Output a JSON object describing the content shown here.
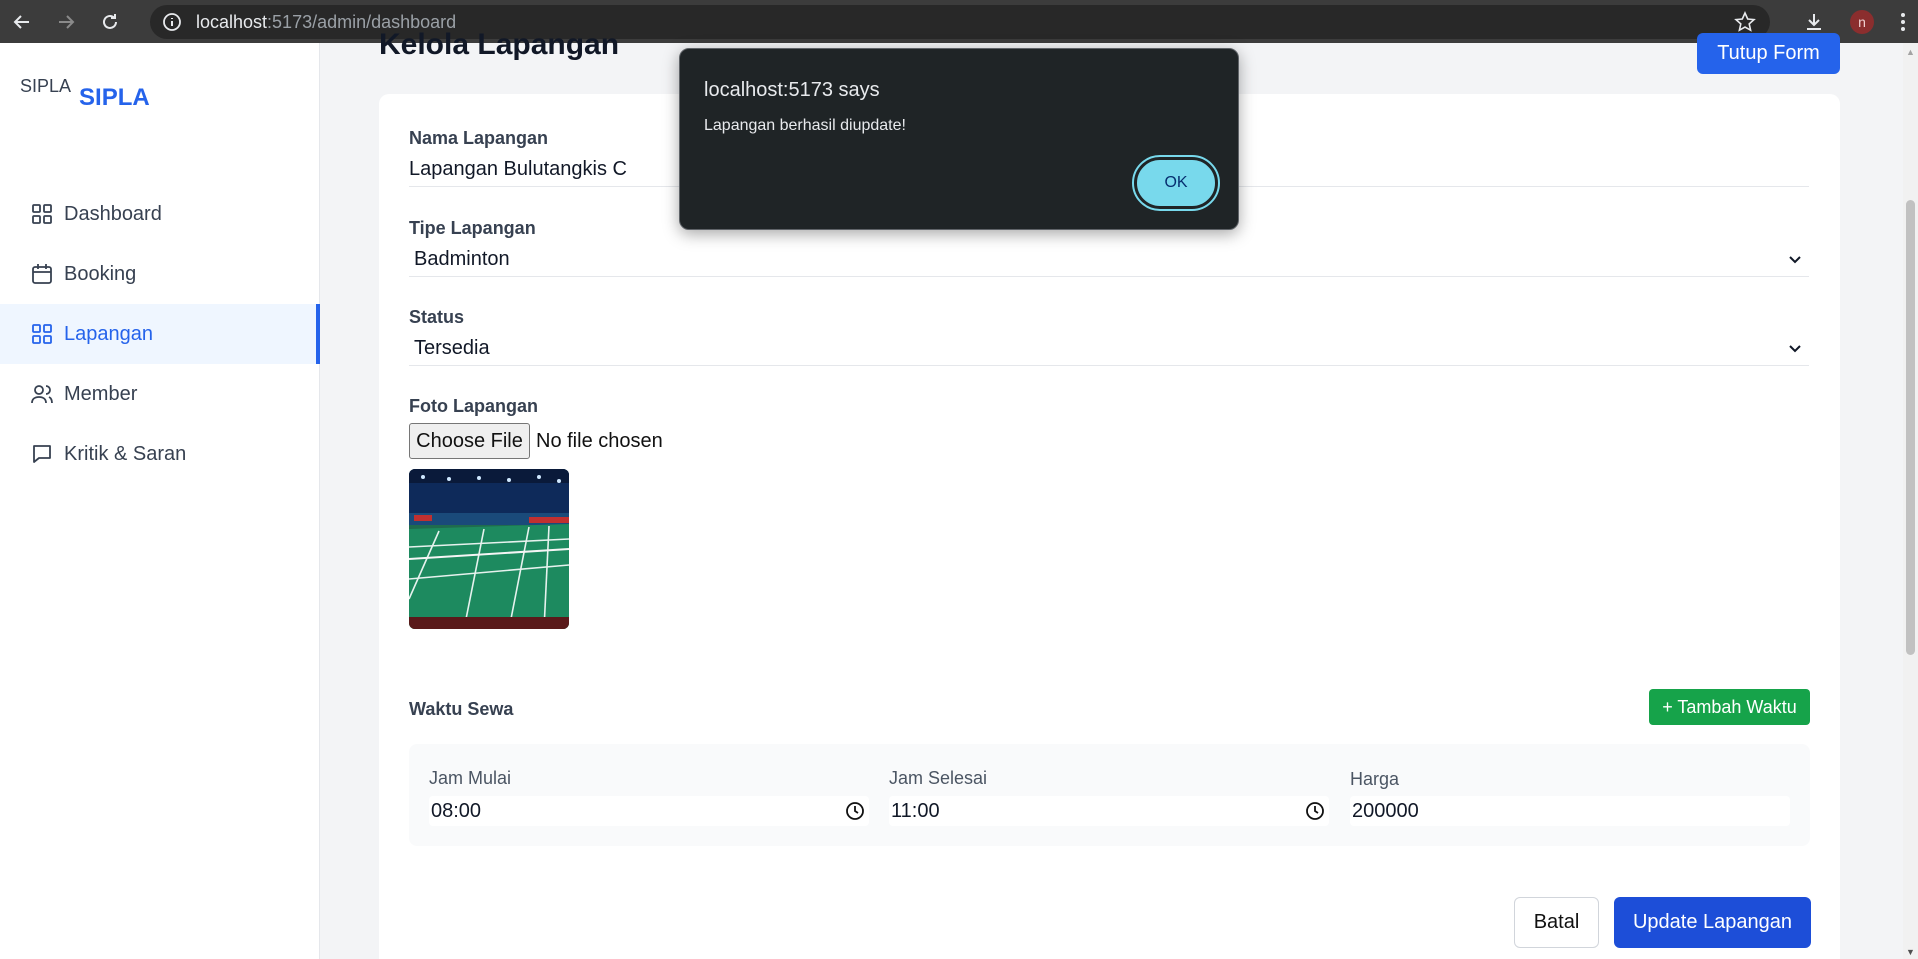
{
  "browser": {
    "url_host": "localhost",
    "url_rest": ":5173/admin/dashboard"
  },
  "sidebar": {
    "logo_alt": "SIPLA",
    "brand": "SIPLA",
    "items": [
      {
        "label": "Dashboard",
        "icon": "grid-icon"
      },
      {
        "label": "Booking",
        "icon": "calendar-icon"
      },
      {
        "label": "Lapangan",
        "icon": "grid-icon",
        "active": true
      },
      {
        "label": "Member",
        "icon": "users-icon"
      },
      {
        "label": "Kritik & Saran",
        "icon": "message-icon"
      }
    ]
  },
  "main": {
    "title": "Kelola Lapangan",
    "close_form": "Tutup Form"
  },
  "form": {
    "nama_label": "Nama Lapangan",
    "nama_value": "Lapangan Bulutangkis C",
    "tipe_label": "Tipe Lapangan",
    "tipe_value": "Badminton",
    "status_label": "Status",
    "status_value": "Tersedia",
    "foto_label": "Foto Lapangan",
    "choose_file": "Choose File",
    "no_file": "No file chosen",
    "waktu_label": "Waktu Sewa",
    "add_time": "+ Tambah Waktu",
    "slots": [
      {
        "start_label": "Jam Mulai",
        "start": "08:00",
        "end_label": "Jam Selesai",
        "end": "11:00",
        "price_label": "Harga",
        "price": "200000"
      }
    ],
    "cancel": "Batal",
    "submit": "Update Lapangan"
  },
  "dialog": {
    "title": "localhost:5173 says",
    "message": "Lapangan berhasil diupdate!",
    "ok": "OK"
  },
  "colors": {
    "primary": "#2563eb",
    "success": "#16a34a",
    "dialog_bg": "#1f2426",
    "ok_button": "#78d9ec"
  }
}
